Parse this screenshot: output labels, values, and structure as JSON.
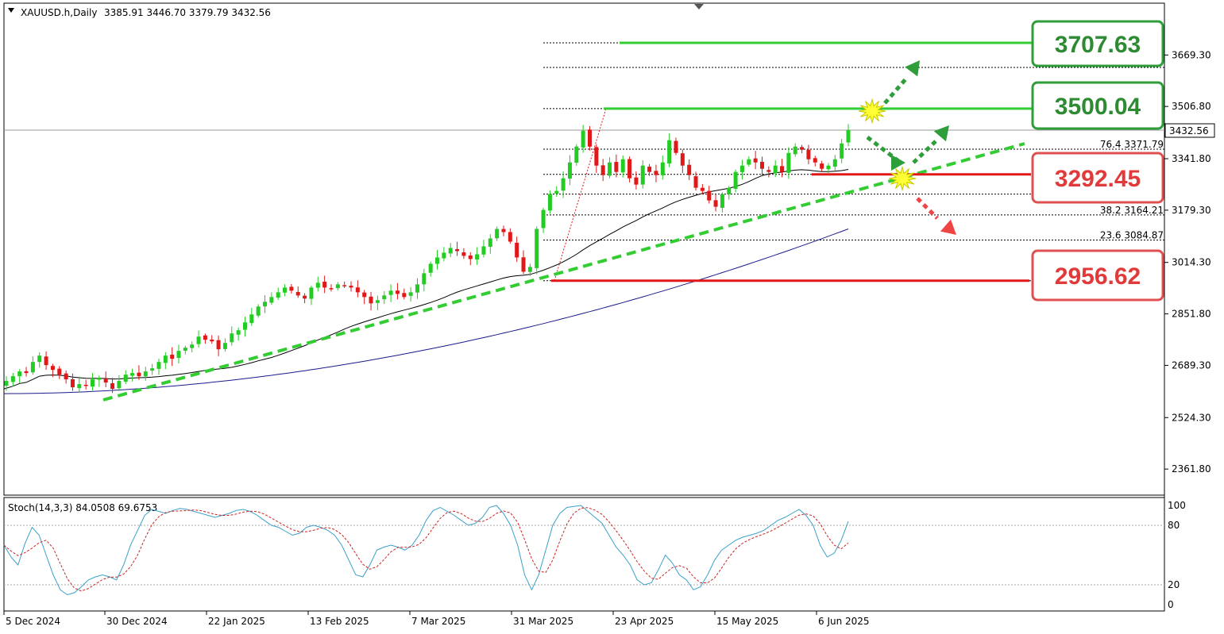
{
  "header": {
    "symbol": "XAUUSD.h,Daily",
    "ohlc": "3385.91 3446.70 3379.79 3432.56"
  },
  "stoch_header": "Stoch(14,3,3) 84.0508 69.6753",
  "colors": {
    "bull": "#22cc22",
    "bear": "#e01818",
    "sma_black": "#000000",
    "sma_blue": "#1a1a8c",
    "trend_green": "#33cc33",
    "level_green": "#33cc33",
    "level_red": "#e01818",
    "stoch_main": "#3aa0c8",
    "stoch_signal": "#cc2222"
  },
  "chart_data": {
    "type": "candlestick",
    "y_ticks": [
      "3669.30",
      "3506.80",
      "3341.80",
      "3179.30",
      "3014.30",
      "2851.80",
      "2689.30",
      "2524.30",
      "2361.80"
    ],
    "ylim": [
      2280,
      3740
    ],
    "x_labels": [
      "5 Dec 2024",
      "30 Dec 2024",
      "22 Jan 2025",
      "13 Feb 2025",
      "7 Mar 2025",
      "31 Mar 2025",
      "23 Apr 2025",
      "15 May 2025",
      "6 Jun 2025"
    ],
    "current_price": "3432.56",
    "fib_levels": [
      {
        "label": "76.4 3371.79",
        "value": 3371.79
      },
      {
        "label": "38.2 3164.21",
        "value": 3164.21
      },
      {
        "label": "23.6 3084.87",
        "value": 3084.87
      }
    ],
    "fib_extra_lines": [
      3707.63,
      3630,
      3500.04,
      3292.45,
      3230,
      2956.62
    ],
    "key_levels": [
      {
        "label": "3707.63",
        "value": 3707.63,
        "color": "green"
      },
      {
        "label": "3500.04",
        "value": 3500.04,
        "color": "green"
      },
      {
        "label": "3292.45",
        "value": 3292.45,
        "color": "red"
      },
      {
        "label": "2956.62",
        "value": 2956.62,
        "color": "red"
      }
    ],
    "candles_close": [
      2640,
      2655,
      2670,
      2665,
      2700,
      2720,
      2690,
      2675,
      2660,
      2645,
      2620,
      2630,
      2625,
      2645,
      2650,
      2635,
      2615,
      2640,
      2660,
      2665,
      2655,
      2670,
      2680,
      2700,
      2720,
      2710,
      2735,
      2745,
      2755,
      2780,
      2770,
      2765,
      2740,
      2760,
      2790,
      2800,
      2825,
      2850,
      2875,
      2890,
      2905,
      2920,
      2935,
      2925,
      2910,
      2900,
      2935,
      2950,
      2935,
      2930,
      2945,
      2940,
      2935,
      2920,
      2905,
      2885,
      2895,
      2910,
      2925,
      2915,
      2905,
      2920,
      2945,
      2980,
      3010,
      3030,
      3045,
      3060,
      3050,
      3035,
      3025,
      3040,
      3065,
      3090,
      3120,
      3110,
      3080,
      3030,
      2985,
      3000,
      3120,
      3180,
      3230,
      3240,
      3280,
      3330,
      3380,
      3430,
      3380,
      3320,
      3290,
      3330,
      3300,
      3340,
      3280,
      3260,
      3320,
      3300,
      3290,
      3330,
      3400,
      3360,
      3320,
      3290,
      3250,
      3240,
      3210,
      3190,
      3230,
      3250,
      3300,
      3320,
      3340,
      3330,
      3310,
      3300,
      3320,
      3300,
      3360,
      3380,
      3370,
      3340,
      3330,
      3310,
      3320,
      3340,
      3390,
      3432.56
    ],
    "stoch_levels": [
      "100",
      "80",
      "20",
      "0"
    ]
  }
}
